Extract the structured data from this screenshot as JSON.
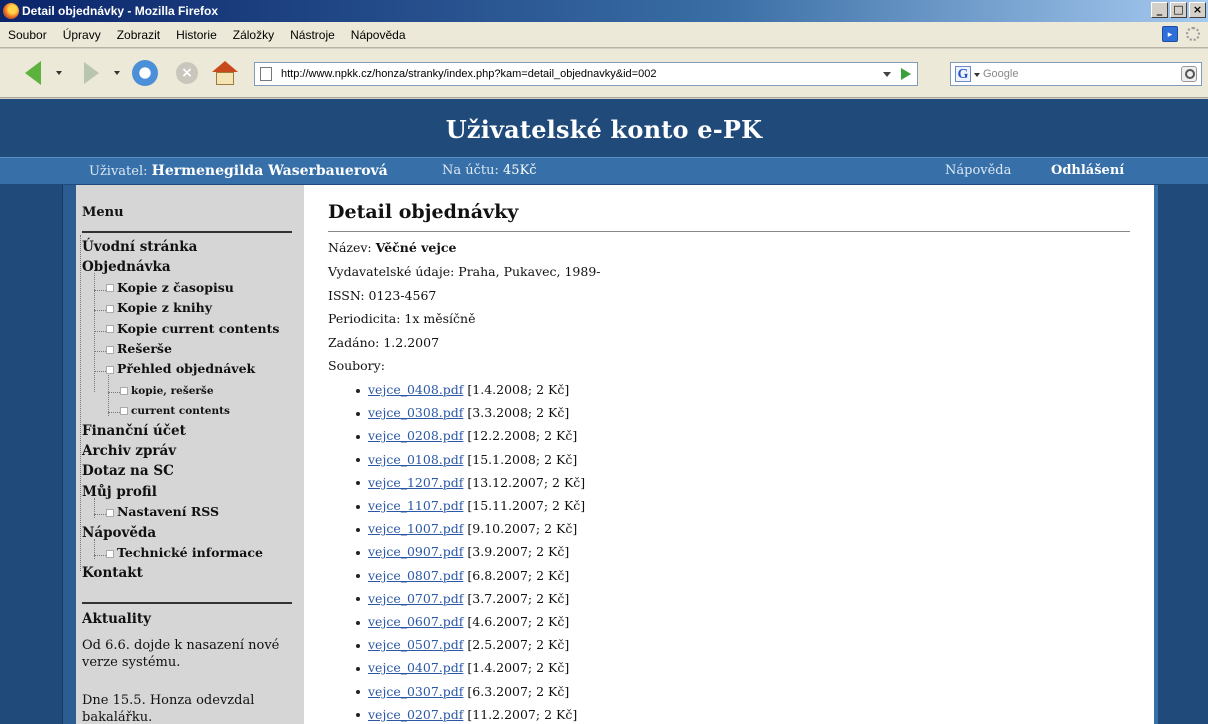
{
  "window": {
    "title": "Detail objednávky - Mozilla Firefox",
    "buttons": [
      "_",
      "□",
      "×"
    ]
  },
  "menubar": [
    "Soubor",
    "Úpravy",
    "Zobrazit",
    "Historie",
    "Záložky",
    "Nástroje",
    "Nápověda"
  ],
  "toolbar": {
    "url": "http://www.npkk.cz/honza/stranky/index.php?kam=detail_objednavky&id=002",
    "search_placeholder": "Google",
    "search_engine_letter": "G"
  },
  "site": {
    "title": "Uživatelské konto e-PK",
    "user_label": "Uživatel:",
    "user_name": "Hermenegilda Waserbauerová",
    "account_label": "Na účtu:",
    "account_value": "45Kč",
    "help": "Nápověda",
    "logout": "Odhlášení"
  },
  "sidebar": {
    "menu_title": "Menu",
    "items": [
      {
        "label": "Úvodní stránka",
        "level": 0
      },
      {
        "label": "Objednávka",
        "level": 0
      },
      {
        "label": "Kopie z časopisu",
        "level": 1
      },
      {
        "label": "Kopie z knihy",
        "level": 1
      },
      {
        "label": "Kopie current contents",
        "level": 1
      },
      {
        "label": "Rešerše",
        "level": 1
      },
      {
        "label": "Přehled objednávek",
        "level": 1
      },
      {
        "label": "kopie, rešerše",
        "level": 2
      },
      {
        "label": "current contents",
        "level": 2
      },
      {
        "label": "Finanční účet",
        "level": 0
      },
      {
        "label": "Archiv zpráv",
        "level": 0
      },
      {
        "label": "Dotaz na SC",
        "level": 0
      },
      {
        "label": "Můj profil",
        "level": 0
      },
      {
        "label": "Nastavení RSS",
        "level": 1
      },
      {
        "label": "Nápověda",
        "level": 0
      },
      {
        "label": "Technické informace",
        "level": 1
      },
      {
        "label": "Kontakt",
        "level": 0
      }
    ],
    "news_title": "Aktuality",
    "news": [
      "Od 6.6. dojde k nasazení nové verze systému.",
      "Dne 15.5. Honza odevzdal bakalářku."
    ]
  },
  "main": {
    "heading": "Detail objednávky",
    "name_label": "Název:",
    "name_value": "Věčné vejce",
    "publisher": "Vydavatelské údaje: Praha, Pukavec, 1989-",
    "issn": "ISSN: 0123-4567",
    "periodicity": "Periodicita: 1x měsíčně",
    "entered": "Zadáno: 1.2.2007",
    "files_label": "Soubory:",
    "files": [
      {
        "name": "vejce_0408.pdf",
        "info": "[1.4.2008; 2 Kč]"
      },
      {
        "name": "vejce_0308.pdf",
        "info": "[3.3.2008; 2 Kč]"
      },
      {
        "name": "vejce_0208.pdf",
        "info": "[12.2.2008; 2 Kč]"
      },
      {
        "name": "vejce_0108.pdf",
        "info": "[15.1.2008; 2 Kč]"
      },
      {
        "name": "vejce_1207.pdf",
        "info": "[13.12.2007; 2 Kč]"
      },
      {
        "name": "vejce_1107.pdf",
        "info": "[15.11.2007; 2 Kč]"
      },
      {
        "name": "vejce_1007.pdf",
        "info": "[9.10.2007; 2 Kč]"
      },
      {
        "name": "vejce_0907.pdf",
        "info": "[3.9.2007; 2 Kč]"
      },
      {
        "name": "vejce_0807.pdf",
        "info": "[6.8.2007; 2 Kč]"
      },
      {
        "name": "vejce_0707.pdf",
        "info": "[3.7.2007; 2 Kč]"
      },
      {
        "name": "vejce_0607.pdf",
        "info": "[4.6.2007; 2 Kč]"
      },
      {
        "name": "vejce_0507.pdf",
        "info": "[2.5.2007; 2 Kč]"
      },
      {
        "name": "vejce_0407.pdf",
        "info": "[1.4.2007; 2 Kč]"
      },
      {
        "name": "vejce_0307.pdf",
        "info": "[6.3.2007; 2 Kč]"
      },
      {
        "name": "vejce_0207.pdf",
        "info": "[11.2.2007; 2 Kč]"
      }
    ]
  }
}
